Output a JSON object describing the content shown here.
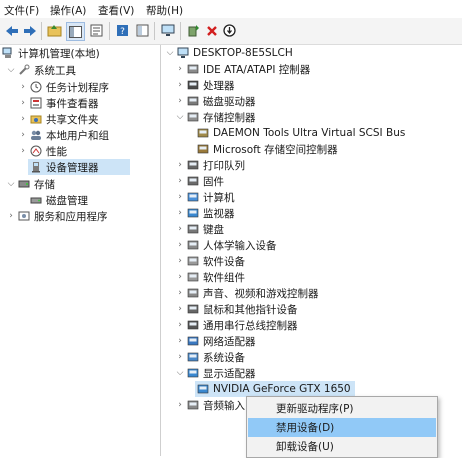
{
  "menubar": {
    "items": [
      {
        "label": "文件(F)"
      },
      {
        "label": "操作(A)"
      },
      {
        "label": "查看(V)"
      },
      {
        "label": "帮助(H)"
      }
    ]
  },
  "toolbar": {
    "icons": [
      "back-arrow-icon",
      "forward-arrow-icon",
      "up-folder-icon",
      "show-hide-tree-icon",
      "properties-icon",
      "help-icon",
      "monitor-icon",
      "update-driver-icon",
      "uninstall-icon",
      "disable-icon"
    ]
  },
  "left_tree": {
    "root": "计算机管理(本地)",
    "system_tools": "系统工具",
    "task_scheduler": "任务计划程序",
    "event_viewer": "事件查看器",
    "shared_folders": "共享文件夹",
    "local_users": "本地用户和组",
    "performance": "性能",
    "device_manager": "设备管理器",
    "storage": "存储",
    "disk_management": "磁盘管理",
    "services": "服务和应用程序"
  },
  "device_tree": {
    "computer": "DESKTOP-8E5SLCH",
    "items": [
      {
        "label": "IDE ATA/ATAPI 控制器",
        "icon": "ide-controller-icon"
      },
      {
        "label": "处理器",
        "icon": "processor-icon"
      },
      {
        "label": "磁盘驱动器",
        "icon": "disk-drive-icon"
      },
      {
        "label": "存储控制器",
        "icon": "storage-controller-icon",
        "expanded": true
      },
      {
        "label": "DAEMON Tools Ultra Virtual SCSI Bus",
        "icon": "scsi-icon",
        "child": true
      },
      {
        "label": "Microsoft 存储空间控制器",
        "icon": "storage-space-icon",
        "child": true
      },
      {
        "label": "打印队列",
        "icon": "printer-icon"
      },
      {
        "label": "固件",
        "icon": "firmware-icon"
      },
      {
        "label": "计算机",
        "icon": "computer-icon"
      },
      {
        "label": "监视器",
        "icon": "monitor-icon"
      },
      {
        "label": "键盘",
        "icon": "keyboard-icon"
      },
      {
        "label": "人体学输入设备",
        "icon": "hid-icon"
      },
      {
        "label": "软件设备",
        "icon": "software-device-icon"
      },
      {
        "label": "软件组件",
        "icon": "software-component-icon"
      },
      {
        "label": "声音、视频和游戏控制器",
        "icon": "sound-icon"
      },
      {
        "label": "鼠标和其他指针设备",
        "icon": "mouse-icon"
      },
      {
        "label": "通用串行总线控制器",
        "icon": "usb-icon"
      },
      {
        "label": "网络适配器",
        "icon": "network-adapter-icon"
      },
      {
        "label": "系统设备",
        "icon": "system-device-icon"
      },
      {
        "label": "显示适配器",
        "icon": "display-adapter-icon",
        "expanded": true
      },
      {
        "label": "NVIDIA GeForce GTX 1650",
        "icon": "gpu-icon",
        "child": true,
        "selected": true
      },
      {
        "label": "音频输入",
        "icon": "audio-input-icon",
        "partial": true
      }
    ]
  },
  "context_menu": {
    "items": [
      {
        "label": "更新驱动程序(P)"
      },
      {
        "label": "禁用设备(D)",
        "highlighted": true
      },
      {
        "label": "卸载设备(U)"
      }
    ]
  },
  "colors": {
    "selection": "#cde4f7",
    "menu_highlight": "#91c9f7",
    "accent_blue": "#2f6fb8",
    "delete_red": "#d21f1f"
  }
}
